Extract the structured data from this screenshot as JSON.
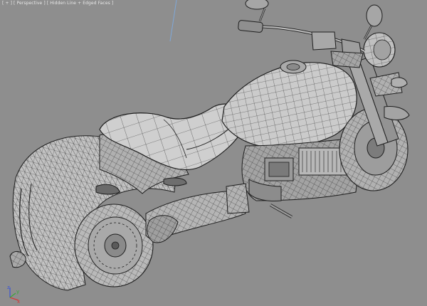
{
  "viewport": {
    "label_parts": [
      "[ + ]",
      " [ ",
      "Perspective",
      " ] ",
      "[ ",
      "Hidden Line + Edged Faces",
      " ]"
    ],
    "background": "#8e8e8e",
    "wire_color": "#1e1e1e",
    "shade_light": "#c9c9c9",
    "shade_mid": "#a6a6a6",
    "shade_dark": "#6a6a6a"
  },
  "axis_gizmo": {
    "x_label": "x",
    "y_label": "y",
    "z_label": "z",
    "x_color": "#d23a3a",
    "y_color": "#38a838",
    "z_color": "#3a54d8"
  },
  "scene": {
    "object": "motorcycle-wireframe-model"
  }
}
